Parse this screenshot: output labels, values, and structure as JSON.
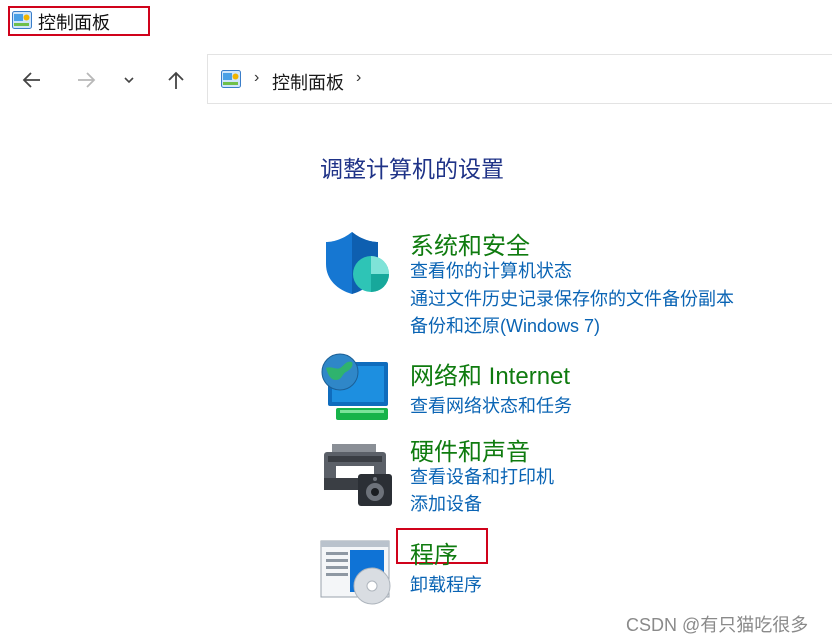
{
  "window": {
    "title": "控制面板",
    "icon": "control-panel-icon"
  },
  "nav": {
    "back_icon": "arrow-left-icon",
    "forward_icon": "arrow-right-icon",
    "recent_icon": "chevron-down-icon",
    "up_icon": "arrow-up-icon"
  },
  "address": {
    "location": "控制面板"
  },
  "heading": "调整计算机的设置",
  "categories": [
    {
      "title": "系统和安全",
      "icon": "shield-icon",
      "links": [
        "查看你的计算机状态",
        "通过文件历史记录保存你的文件备份副本",
        "备份和还原(Windows 7)"
      ]
    },
    {
      "title": "网络和 Internet",
      "icon": "network-globe-icon",
      "links": [
        "查看网络状态和任务"
      ]
    },
    {
      "title": "硬件和声音",
      "icon": "printer-speaker-icon",
      "links": [
        "查看设备和打印机",
        "添加设备"
      ]
    },
    {
      "title": "程序",
      "icon": "programs-disc-icon",
      "links": [
        "卸载程序"
      ]
    }
  ],
  "colors": {
    "category_title": "#0f7b0f",
    "link": "#0a64b4",
    "heading": "#1e3287",
    "highlight": "#d0021b"
  },
  "watermark": "CSDN @有只猫吃很多"
}
